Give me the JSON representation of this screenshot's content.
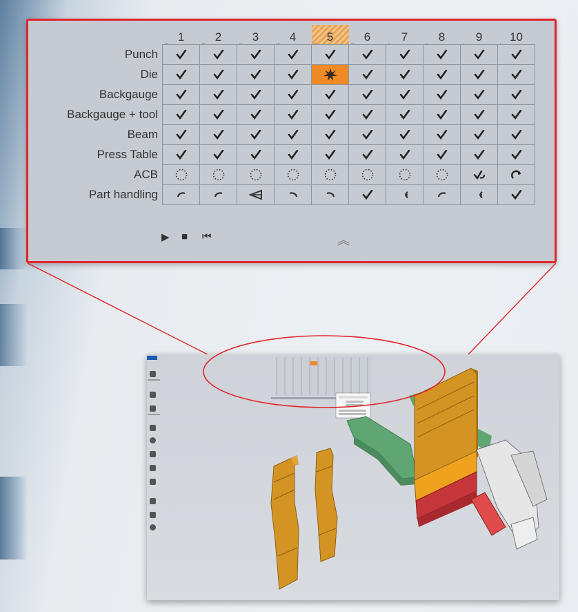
{
  "columns": [
    "1",
    "2",
    "3",
    "4",
    "5",
    "6",
    "7",
    "8",
    "9",
    "10"
  ],
  "column_markers": [
    "...",
    "...",
    "...",
    "...",
    "...",
    "...",
    "..",
    "..",
    ".",
    "."
  ],
  "selected_column": "5",
  "rows": [
    {
      "label": "Punch",
      "cells": [
        "check",
        "check",
        "check",
        "check",
        "check",
        "check",
        "check",
        "check",
        "check",
        "check"
      ]
    },
    {
      "label": "Die",
      "cells": [
        "check",
        "check",
        "check",
        "check",
        "collision",
        "check",
        "check",
        "check",
        "check",
        "check"
      ]
    },
    {
      "label": "Backgauge",
      "cells": [
        "check",
        "check",
        "check",
        "check",
        "check",
        "check",
        "check",
        "check",
        "check",
        "check"
      ]
    },
    {
      "label": "Backgauge + tool",
      "cells": [
        "check",
        "check",
        "check",
        "check",
        "check",
        "check",
        "check",
        "check",
        "check",
        "check"
      ]
    },
    {
      "label": "Beam",
      "cells": [
        "check",
        "check",
        "check",
        "check",
        "check",
        "check",
        "check",
        "check",
        "check",
        "check"
      ]
    },
    {
      "label": "Press Table",
      "cells": [
        "check",
        "check",
        "check",
        "check",
        "check",
        "check",
        "check",
        "check",
        "check",
        "check"
      ]
    },
    {
      "label": "ACB",
      "cells": [
        "dotted-circle",
        "dotted-circle",
        "dotted-circle",
        "dotted-circle",
        "dotted-circle",
        "dotted-circle",
        "dotted-circle",
        "dotted-circle",
        "check-arrow",
        "redo-arrow"
      ]
    },
    {
      "label": "Part handling",
      "cells": [
        "arc-left",
        "arc-left",
        "flip-icon",
        "arc-right",
        "arc-right",
        "check",
        "grip-left",
        "arc-left",
        "grip-left",
        "check"
      ]
    }
  ],
  "controls": {
    "play": "▶",
    "stop": "■",
    "rewind": "⏮",
    "collapse": "︽"
  },
  "colors": {
    "highlight": "#e0252b",
    "collision": "#f08a24",
    "panel_bg": "#c6cad1"
  }
}
